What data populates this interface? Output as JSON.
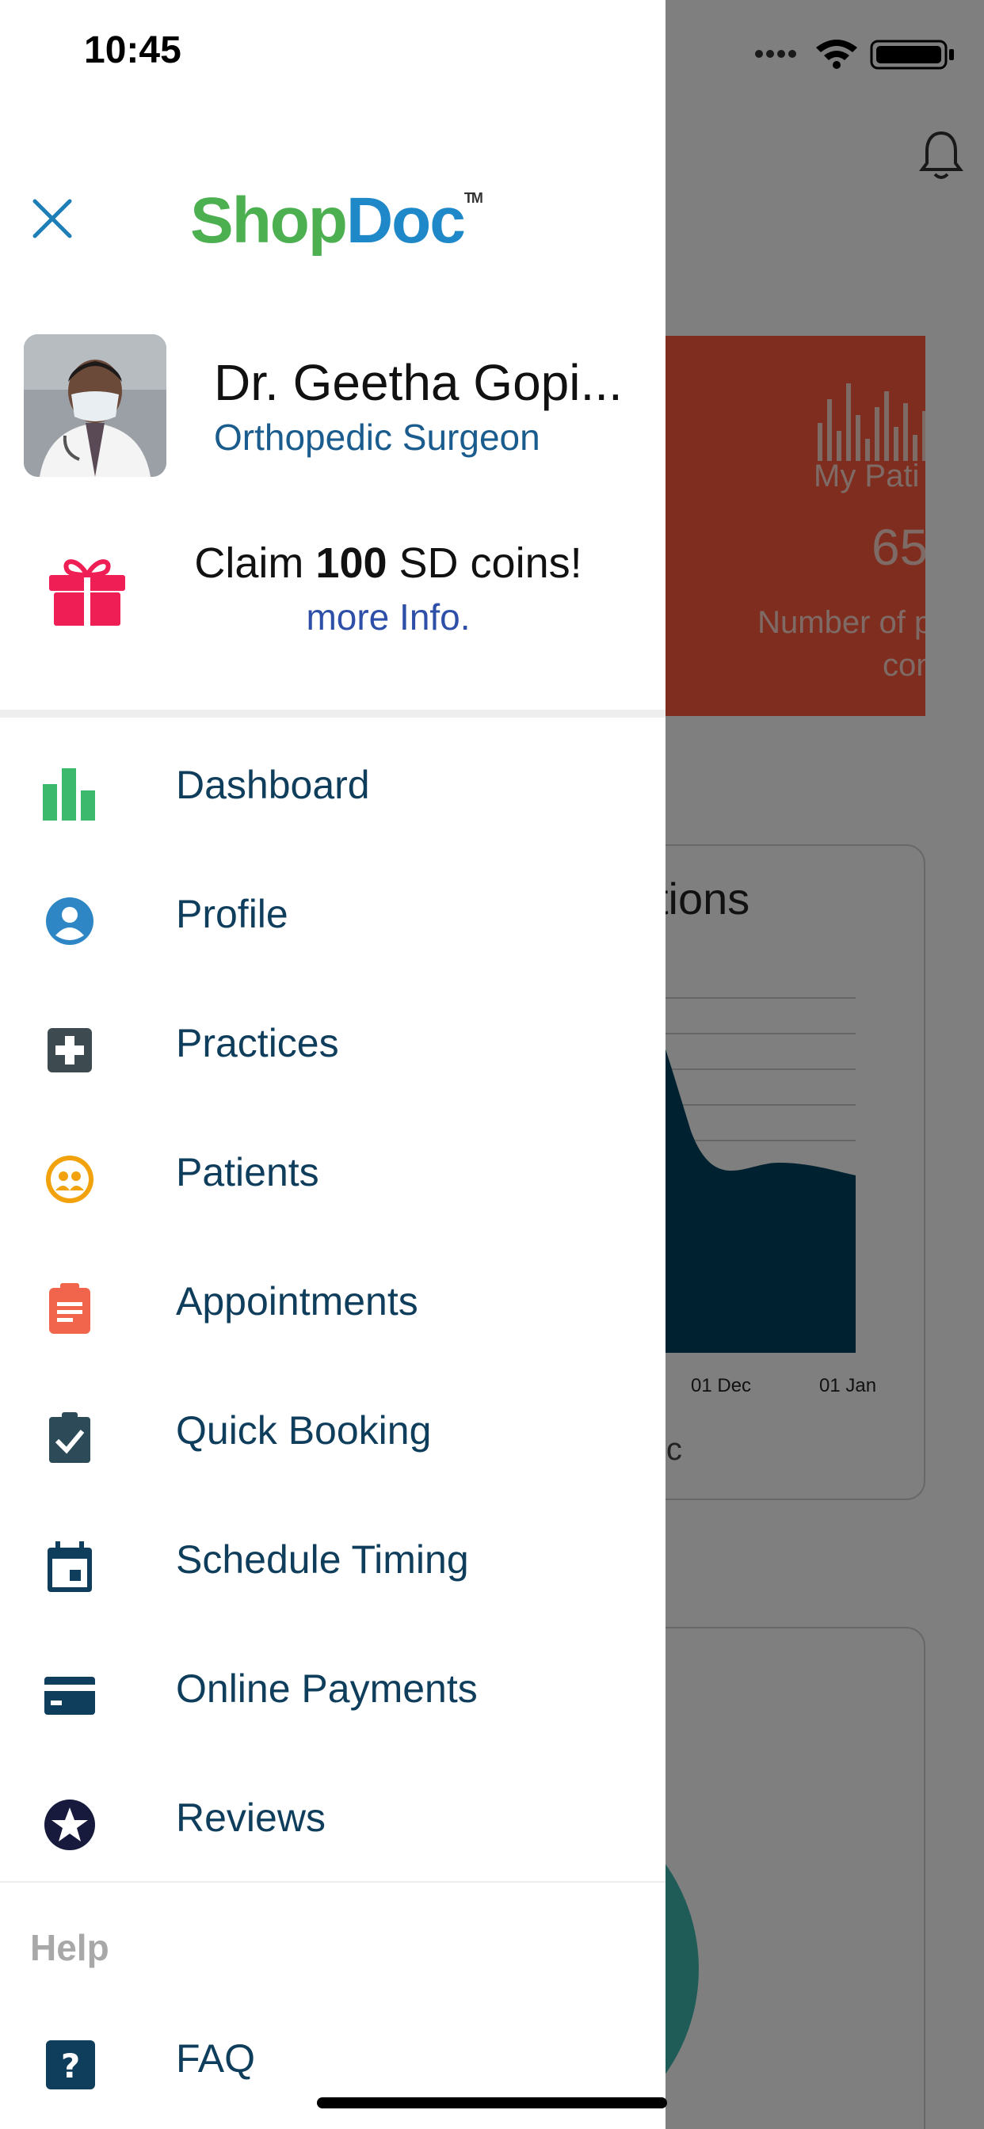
{
  "status_bar": {
    "time": "10:45"
  },
  "drawer": {
    "brand": {
      "part1": "Shop",
      "part2": "Doc",
      "tm": "TM"
    },
    "profile": {
      "name": "Dr. Geetha Gopi...",
      "specialty": "Orthopedic Surgeon"
    },
    "promo": {
      "claim_prefix": "Claim ",
      "claim_amount": "100",
      "claim_suffix": " SD coins!",
      "link": "more Info."
    },
    "menu": [
      {
        "label": "Dashboard",
        "icon": "bar-chart-icon",
        "color": "#3cb96d"
      },
      {
        "label": "Profile",
        "icon": "user-circle-icon",
        "color": "#2f86c5"
      },
      {
        "label": "Practices",
        "icon": "medical-cross-icon",
        "color": "#3d4a4f"
      },
      {
        "label": "Patients",
        "icon": "users-circle-icon",
        "color": "#f2a20d"
      },
      {
        "label": "Appointments",
        "icon": "clipboard-icon",
        "color": "#f2654d"
      },
      {
        "label": "Quick Booking",
        "icon": "clipboard-check-icon",
        "color": "#2c4a58"
      },
      {
        "label": "Schedule Timing",
        "icon": "calendar-icon",
        "color": "#0f3d5c"
      },
      {
        "label": "Online Payments",
        "icon": "credit-card-icon",
        "color": "#0f3d5c"
      },
      {
        "label": "Reviews",
        "icon": "star-circle-icon",
        "color": "#171a3d"
      }
    ],
    "help": {
      "title": "Help",
      "items": [
        {
          "label": "FAQ",
          "icon": "question-square-icon",
          "color": "#0f3d5c"
        }
      ]
    }
  },
  "background": {
    "stat_card": {
      "title": "My Pati",
      "value": "65",
      "description": "Number of patien consulta",
      "color": "#ff5a3d"
    },
    "chart_card": {
      "title": "tions",
      "x_ticks": [
        "01 Dec",
        "01 Jan"
      ],
      "footer": "ic",
      "color": "#00425f"
    }
  }
}
